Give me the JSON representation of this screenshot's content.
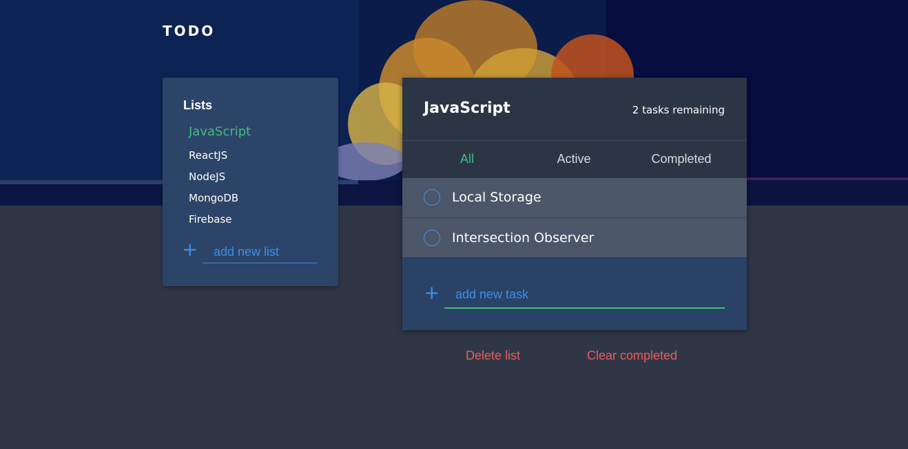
{
  "app": {
    "title": "TODO"
  },
  "sidebar": {
    "heading": "Lists",
    "items": [
      {
        "label": "JavaScript",
        "active": true
      },
      {
        "label": "ReactJS",
        "active": false
      },
      {
        "label": "NodeJS",
        "active": false
      },
      {
        "label": "MongoDB",
        "active": false
      },
      {
        "label": "Firebase",
        "active": false
      }
    ],
    "add_list": {
      "icon": "plus-icon",
      "placeholder": "add new list",
      "value": ""
    }
  },
  "main": {
    "list_title": "JavaScript",
    "remaining": "2 tasks remaining",
    "filters": [
      {
        "label": "All",
        "active": true
      },
      {
        "label": "Active",
        "active": false
      },
      {
        "label": "Completed",
        "active": false
      }
    ],
    "tasks": [
      {
        "label": "Local Storage",
        "completed": false
      },
      {
        "label": "Intersection Observer",
        "completed": false
      }
    ],
    "add_task": {
      "icon": "plus-icon",
      "placeholder": "add new task",
      "value": ""
    }
  },
  "actions": {
    "delete_list": "Delete list",
    "clear_completed": "Clear completed"
  },
  "colors": {
    "accent_green": "#3fbf7f",
    "accent_blue": "#3c8ee6",
    "danger": "#ee5a5a",
    "background": "#2f3747",
    "panel_blue": "#2c4467"
  }
}
